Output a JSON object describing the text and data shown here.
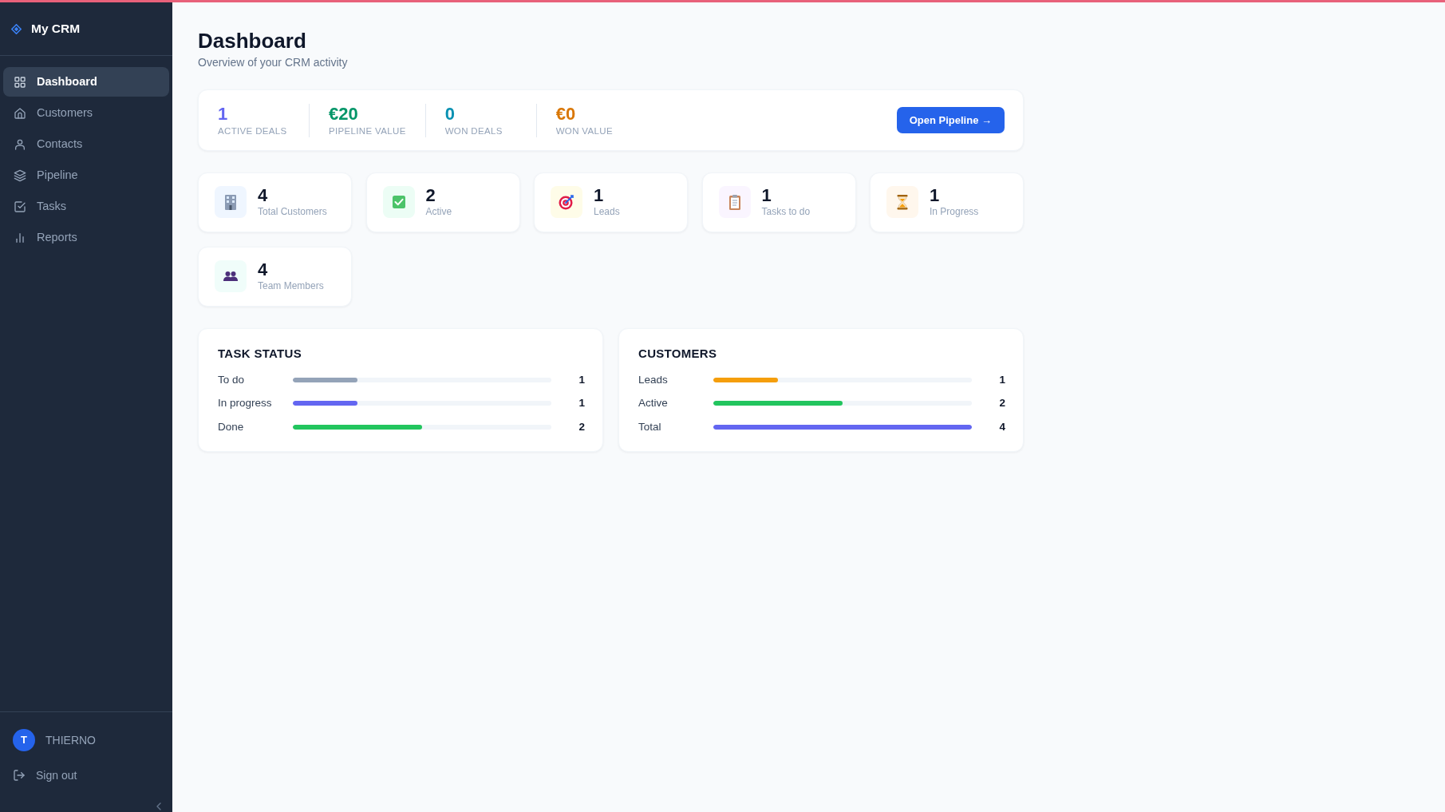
{
  "sidebar": {
    "brand": "My CRM",
    "nav": [
      {
        "label": "Dashboard",
        "selected": true
      },
      {
        "label": "Customers",
        "selected": false
      },
      {
        "label": "Contacts",
        "selected": false
      },
      {
        "label": "Pipeline",
        "selected": false
      },
      {
        "label": "Tasks",
        "selected": false
      },
      {
        "label": "Reports",
        "selected": false
      }
    ],
    "user": {
      "initial": "T",
      "name": "THIERNO"
    },
    "sign_out": "Sign out"
  },
  "header": {
    "title": "Dashboard",
    "subtitle": "Overview of your CRM activity"
  },
  "summary": {
    "stats": [
      {
        "value": "1",
        "label": "ACTIVE DEALS",
        "color": "#6366f1"
      },
      {
        "value": "€20",
        "label": "PIPELINE VALUE",
        "color": "#059669"
      },
      {
        "value": "0",
        "label": "WON DEALS",
        "color": "#0891b2"
      },
      {
        "value": "€0",
        "label": "WON VALUE",
        "color": "#d97706"
      }
    ],
    "button": "Open Pipeline →"
  },
  "cards": [
    {
      "value": "4",
      "label": "Total Customers"
    },
    {
      "value": "2",
      "label": "Active"
    },
    {
      "value": "1",
      "label": "Leads"
    },
    {
      "value": "1",
      "label": "Tasks to do"
    },
    {
      "value": "1",
      "label": "In Progress"
    },
    {
      "value": "4",
      "label": "Team Members"
    }
  ],
  "panels": [
    {
      "title": "TASK STATUS",
      "rows": [
        {
          "label": "To do",
          "level": 0.25,
          "color": "#94a3b8",
          "count": "1"
        },
        {
          "label": "In progress",
          "level": 0.25,
          "color": "#6366f1",
          "count": "1"
        },
        {
          "label": "Done",
          "level": 0.5,
          "color": "#22c55e",
          "count": "2"
        }
      ]
    },
    {
      "title": "CUSTOMERS",
      "rows": [
        {
          "label": "Leads",
          "level": 0.25,
          "color": "#f59e0b",
          "count": "1"
        },
        {
          "label": "Active",
          "level": 0.5,
          "color": "#22c55e",
          "count": "2"
        },
        {
          "label": "Total",
          "level": 1,
          "color": "#6366f1",
          "count": "4"
        }
      ]
    }
  ]
}
